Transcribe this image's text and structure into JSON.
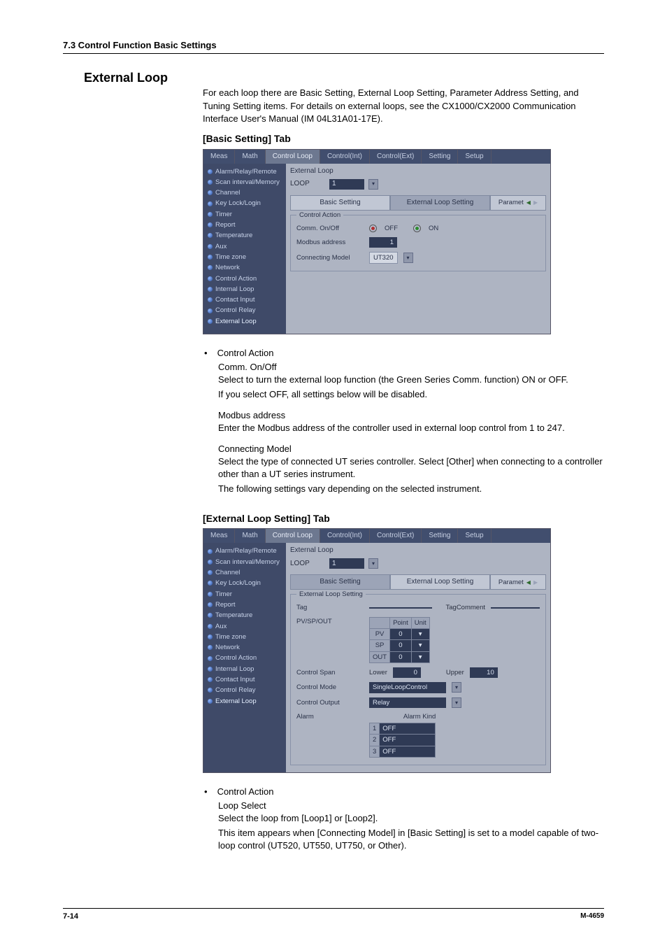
{
  "header": {
    "section_ref": "7.3  Control Function Basic Settings",
    "title": "External Loop"
  },
  "intro": "For each loop there are Basic Setting, External Loop Setting, Parameter Address Setting, and Tuning Setting items. For details on external loops, see the CX1000/CX2000 Communication Interface User's Manual (IM 04L31A01-17E).",
  "tab1": {
    "heading": "[Basic Setting] Tab",
    "tabs": [
      "Meas",
      "Math",
      "Control Loop",
      "Control(Int)",
      "Control(Ext)",
      "Setting",
      "Setup"
    ],
    "active_tab": "Control Loop",
    "sidebar": [
      "Alarm/Relay/Remote",
      "Scan interval/Memory",
      "Channel",
      "Key Lock/Login",
      "Timer",
      "Report",
      "Temperature",
      "Aux",
      "Time zone",
      "Network",
      "Control Action",
      "Internal Loop",
      "Contact Input",
      "Control Relay",
      "External Loop"
    ],
    "sidebar_selected": "External Loop",
    "panel_title": "External Loop",
    "loop_label": "LOOP",
    "loop_value": "1",
    "subtabs": {
      "left": "Basic Setting",
      "right": "External Loop Setting",
      "param": "Paramet"
    },
    "groupbox": "Control Action",
    "rows": {
      "comm": {
        "label": "Comm. On/Off",
        "off": "OFF",
        "on": "ON"
      },
      "modbus": {
        "label": "Modbus address",
        "value": "1"
      },
      "model": {
        "label": "Connecting Model",
        "value": "UT320"
      }
    }
  },
  "text1": {
    "control_action": "Control Action",
    "comm_head": "Comm.  On/Off",
    "comm_p1": "Select to turn the external loop function (the Green Series Comm. function) ON or OFF.",
    "comm_p2": "If you select OFF, all settings below will be disabled.",
    "modbus_head": "Modbus address",
    "modbus_p": "Enter the Modbus address of the controller used in external loop control from 1 to 247.",
    "model_head": "Connecting Model",
    "model_p1": "Select the type of connected UT series controller.  Select [Other] when connecting to a controller other than a UT series instrument.",
    "model_p2": "The following settings vary depending on the selected instrument."
  },
  "tab2": {
    "heading": "[External Loop Setting] Tab",
    "tabs": [
      "Meas",
      "Math",
      "Control Loop",
      "Control(Int)",
      "Control(Ext)",
      "Setting",
      "Setup"
    ],
    "active_tab": "Control Loop",
    "sidebar": [
      "Alarm/Relay/Remote",
      "Scan interval/Memory",
      "Channel",
      "Key Lock/Login",
      "Timer",
      "Report",
      "Temperature",
      "Aux",
      "Time zone",
      "Network",
      "Control Action",
      "Internal Loop",
      "Contact Input",
      "Control Relay",
      "External Loop"
    ],
    "sidebar_selected": "External Loop",
    "panel_title": "External Loop",
    "loop_label": "LOOP",
    "loop_value": "1",
    "subtabs": {
      "left": "Basic Setting",
      "right": "External Loop Setting",
      "param": "Paramet"
    },
    "groupbox": "External Loop Setting",
    "tag_label": "Tag",
    "tagcomment": "TagComment",
    "pvspout": "PV/SP/OUT",
    "grid": {
      "col_point": "Point",
      "col_unit": "Unit",
      "rows": [
        "PV",
        "SP",
        "OUT"
      ],
      "val": "0"
    },
    "span": {
      "label": "Control Span",
      "lower": "Lower",
      "lval": "0",
      "upper": "Upper",
      "uval": "10"
    },
    "mode": {
      "label": "Control Mode",
      "value": "SingleLoopControl"
    },
    "output": {
      "label": "Control Output",
      "value": "Relay"
    },
    "alarm": {
      "label": "Alarm",
      "kind": "Alarm Kind",
      "rows": [
        [
          "1",
          "OFF"
        ],
        [
          "2",
          "OFF"
        ],
        [
          "3",
          "OFF"
        ]
      ]
    }
  },
  "text2": {
    "control_action": "Control Action",
    "loop_head": "Loop Select",
    "loop_p1": "Select the loop from [Loop1] or [Loop2].",
    "loop_p2": "This item appears when [Connecting Model] in [Basic Setting] is set to a model capable of two-loop control (UT520, UT550, UT750, or Other)."
  },
  "footer": {
    "page": "7-14",
    "doc": "M-4659"
  }
}
